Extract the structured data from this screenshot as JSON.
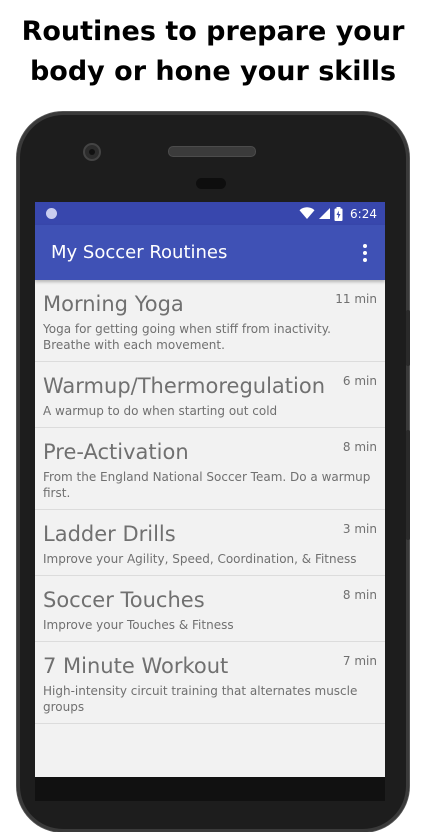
{
  "caption": {
    "line1": "Routines to prepare your",
    "line2": "body or hone your skills"
  },
  "status_bar": {
    "time": "6:24",
    "icons": [
      "wifi-icon",
      "signal-icon",
      "battery-icon"
    ]
  },
  "app_bar": {
    "title": "My Soccer Routines",
    "menu_icon": "more-vert-icon"
  },
  "routines": [
    {
      "title": "Morning Yoga",
      "duration": "11 min",
      "description": "Yoga for getting going when stiff from inactivity. Breathe with each movement."
    },
    {
      "title": "Warmup/Thermoregulation",
      "duration": "6 min",
      "description": "A warmup to do when starting out cold"
    },
    {
      "title": "Pre-Activation",
      "duration": "8 min",
      "description": "From the England National Soccer Team.  Do a warmup first."
    },
    {
      "title": "Ladder Drills",
      "duration": "3 min",
      "description": "Improve your Agility, Speed, Coordination, & Fitness"
    },
    {
      "title": "Soccer Touches",
      "duration": "8 min",
      "description": "Improve your Touches & Fitness"
    },
    {
      "title": "7 Minute Workout",
      "duration": "7 min",
      "description": "High-intensity circuit training that alternates muscle groups"
    }
  ],
  "colors": {
    "status_bar": "#3847ad",
    "app_bar": "#3f51b5",
    "list_background": "#f2f2f2",
    "text_secondary": "#707070"
  }
}
